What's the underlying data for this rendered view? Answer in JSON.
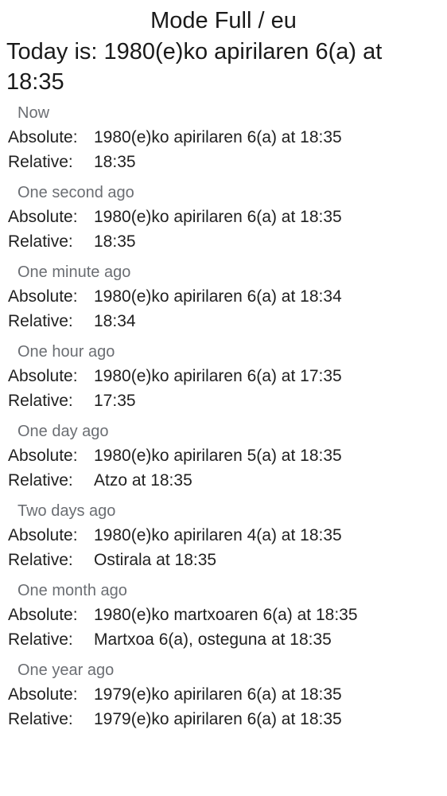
{
  "header": {
    "title": "Mode Full / eu",
    "today": "Today is: 1980(e)ko apirilaren 6(a) at 18:35"
  },
  "labels": {
    "absolute": "Absolute:",
    "relative": "Relative:"
  },
  "entries": [
    {
      "title": "Now",
      "absolute": "1980(e)ko apirilaren 6(a) at 18:35",
      "relative": "18:35"
    },
    {
      "title": "One second ago",
      "absolute": "1980(e)ko apirilaren 6(a) at 18:35",
      "relative": "18:35"
    },
    {
      "title": "One minute ago",
      "absolute": "1980(e)ko apirilaren 6(a) at 18:34",
      "relative": "18:34"
    },
    {
      "title": "One hour ago",
      "absolute": "1980(e)ko apirilaren 6(a) at 17:35",
      "relative": "17:35"
    },
    {
      "title": "One day ago",
      "absolute": "1980(e)ko apirilaren 5(a) at 18:35",
      "relative": "Atzo at 18:35"
    },
    {
      "title": "Two days ago",
      "absolute": "1980(e)ko apirilaren 4(a) at 18:35",
      "relative": "Ostirala at 18:35"
    },
    {
      "title": "One month ago",
      "absolute": "1980(e)ko martxoaren 6(a) at 18:35",
      "relative": "Martxoa 6(a), osteguna at 18:35"
    },
    {
      "title": "One year ago",
      "absolute": "1979(e)ko apirilaren 6(a) at 18:35",
      "relative": "1979(e)ko apirilaren 6(a) at 18:35"
    }
  ]
}
